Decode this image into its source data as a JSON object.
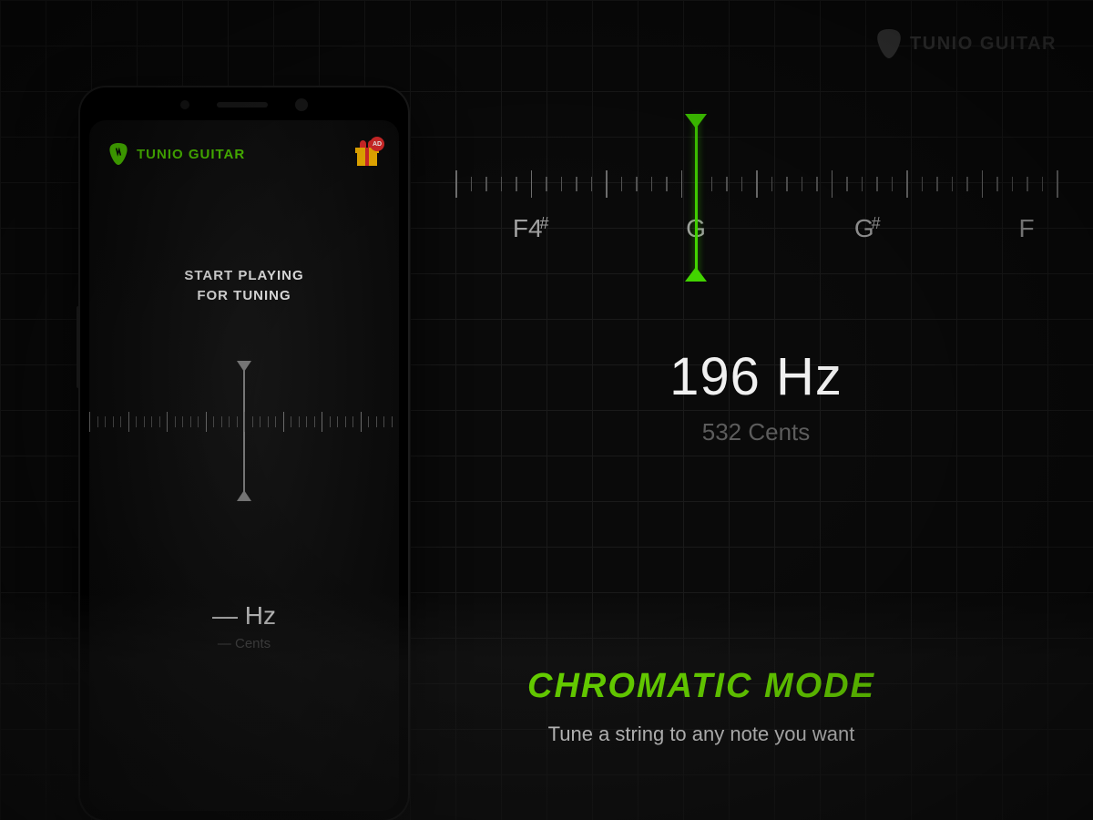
{
  "brand": {
    "name": "TUNIO GUITAR"
  },
  "phone": {
    "app_name": "TUNIO GUITAR",
    "ad_badge": "AD",
    "prompt_line1": "START PLAYING",
    "prompt_line2": "FOR TUNING",
    "readout_hz": "— Hz",
    "readout_cents": "— Cents"
  },
  "tuner": {
    "notes": [
      "F4#",
      "G",
      "G#",
      "F"
    ],
    "needle_position_pct": 40,
    "readout_hz": "196 Hz",
    "readout_cents": "532 Cents"
  },
  "banner": {
    "title": "CHROMATIC MODE",
    "subtitle": "Tune a string to any note you want"
  },
  "colors": {
    "accent": "#54d400",
    "accent_bright": "#6ee000"
  }
}
